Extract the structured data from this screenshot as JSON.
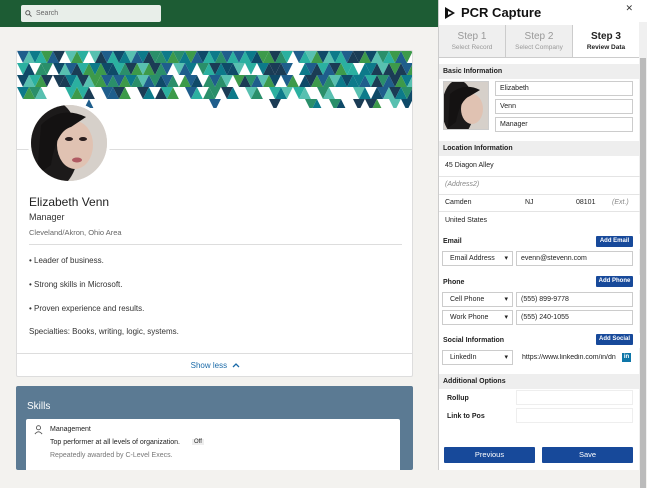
{
  "search": {
    "placeholder": "Search"
  },
  "profile": {
    "name": "Elizabeth Venn",
    "title": "Manager",
    "location": "Cleveland/Akron, Ohio Area",
    "bullets": [
      "• Leader of business.",
      "• Strong skills in Microsoft.",
      "• Proven experience and results."
    ],
    "specialties": "Specialties: Books, writing, logic, systems.",
    "show_less": "Show less"
  },
  "skills": {
    "title": "Skills",
    "item_name": "Management",
    "item_desc": "Top performer at all levels of organization.",
    "item_badge": "Off",
    "item_note": "Repeatedly awarded by C-Level Execs."
  },
  "panel": {
    "title": "PCR Capture",
    "steps": [
      {
        "num": "Step 1",
        "label": "Select Record"
      },
      {
        "num": "Step 2",
        "label": "Select Company"
      },
      {
        "num": "Step 3",
        "label": "Review Data"
      }
    ],
    "basic": {
      "heading": "Basic Information",
      "first": "Elizabeth",
      "last": "Venn",
      "title": "Manager"
    },
    "location": {
      "heading": "Location Information",
      "address1": "45 Diagon Alley",
      "address2": "(Address2)",
      "city": "Camden",
      "state": "NJ",
      "zip": "08101",
      "ext": "(Ext.)",
      "country": "United States"
    },
    "email": {
      "heading": "Email",
      "add": "Add Email",
      "type": "Email Address",
      "value": "evenn@stevenn.com"
    },
    "phone": {
      "heading": "Phone",
      "add": "Add Phone",
      "rows": [
        {
          "type": "Cell Phone",
          "value": "(555) 899-9778"
        },
        {
          "type": "Work Phone",
          "value": "(555) 240-1055"
        }
      ]
    },
    "social": {
      "heading": "Social Information",
      "add": "Add Social",
      "type": "LinkedIn",
      "value": "https://www.linkedin.com/in/dn"
    },
    "additional": {
      "heading": "Additional Options",
      "rollup": "Rollup",
      "link_to_pos": "Link to Pos"
    },
    "previous": "Previous",
    "save": "Save"
  },
  "colors": {
    "topbar": "#1d5c34",
    "accent": "#17499a",
    "link": "#1a6aa8"
  }
}
